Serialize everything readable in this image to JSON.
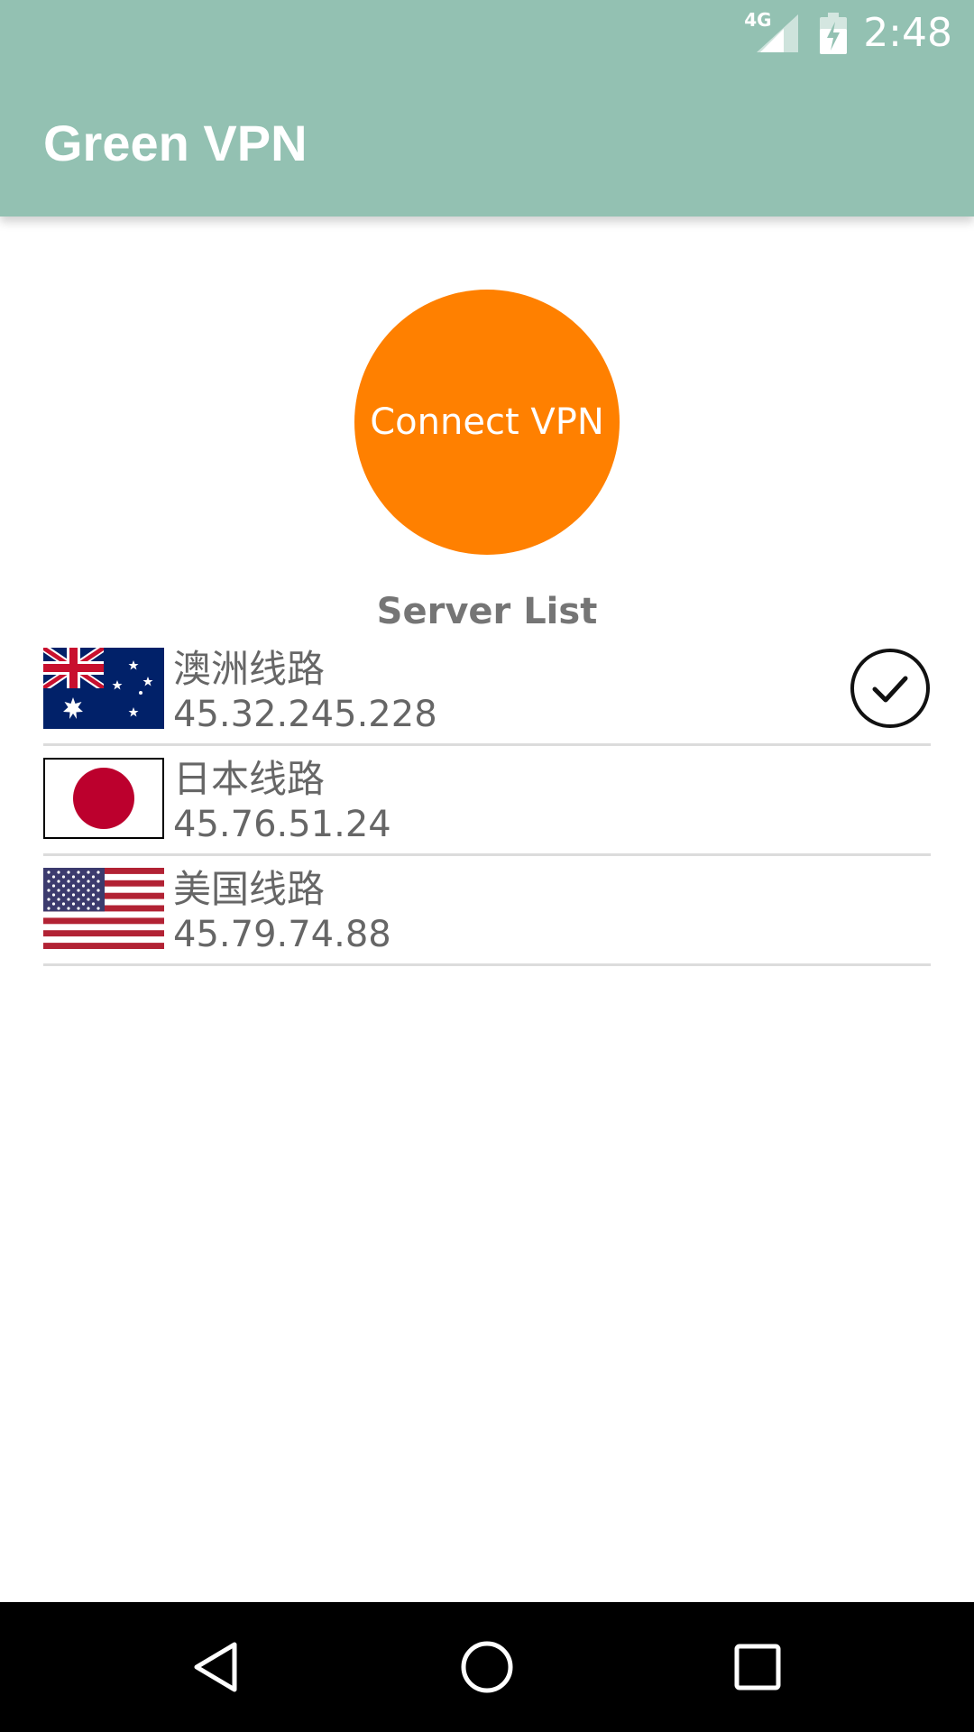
{
  "status_bar": {
    "network_type": "4G",
    "time": "2:48",
    "icons": [
      "signal-icon",
      "battery-charging-icon"
    ]
  },
  "app_bar": {
    "title": "Green VPN",
    "color": "#93c1b2"
  },
  "connect_button": {
    "label": "Connect VPN",
    "color": "#ff8000"
  },
  "server_list": {
    "heading": "Server List",
    "items": [
      {
        "name": "澳洲线路",
        "ip": "45.32.245.228",
        "flag": "australia-flag-icon",
        "selected": true
      },
      {
        "name": "日本线路",
        "ip": "45.76.51.24",
        "flag": "japan-flag-icon",
        "selected": false
      },
      {
        "name": "美国线路",
        "ip": "45.79.74.88",
        "flag": "usa-flag-icon",
        "selected": false
      }
    ]
  },
  "nav_bar": {
    "icons": [
      "back-icon",
      "home-icon",
      "recents-icon"
    ]
  }
}
